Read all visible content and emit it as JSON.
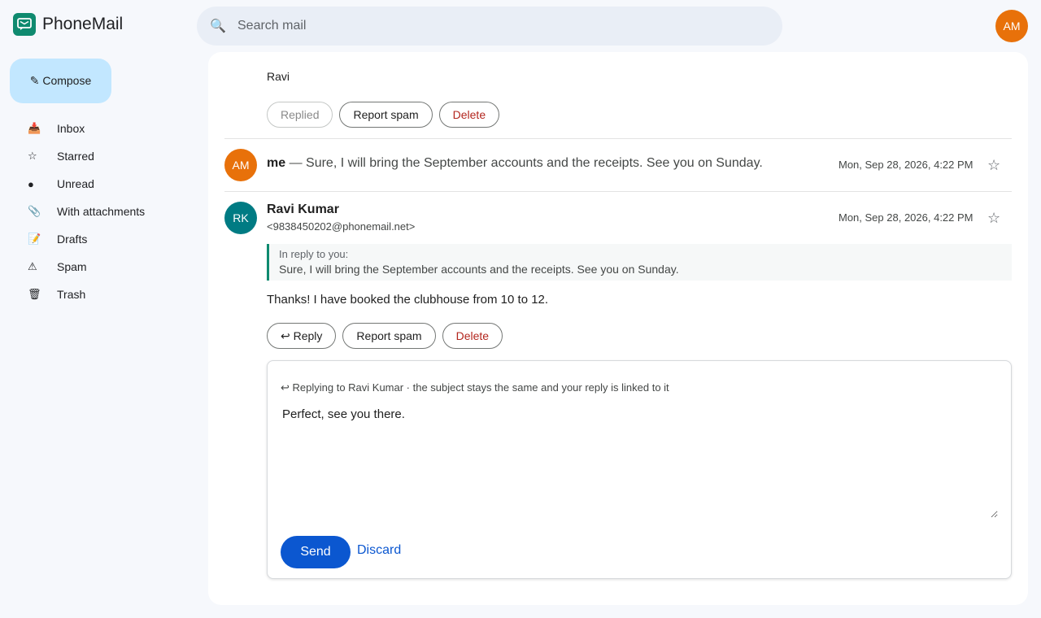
{
  "app": {
    "name": "PhoneMail",
    "logo_icon": "mail-chat-icon",
    "accent": "#0f8a6f"
  },
  "search": {
    "placeholder": "Search mail",
    "icon": "search-icon"
  },
  "user": {
    "initials": "AM",
    "color": "#e8710a"
  },
  "sidebar": {
    "compose_label": "✎ Compose",
    "items": [
      {
        "icon": "📥",
        "label": "Inbox"
      },
      {
        "icon": "☆",
        "label": "Starred"
      },
      {
        "icon": "●",
        "label": "Unread"
      },
      {
        "icon": "📎",
        "label": "With attachments"
      },
      {
        "icon": "📝",
        "label": "Drafts"
      },
      {
        "icon": "⚠",
        "label": "Spam"
      },
      {
        "icon": "🗑",
        "label": "Trash"
      }
    ]
  },
  "thread": {
    "first_message": {
      "signature": "Ravi",
      "actions": {
        "replied": "Replied",
        "report_spam": "Report spam",
        "delete": "Delete"
      }
    },
    "second_message": {
      "avatar_initials": "AM",
      "avatar_color": "#e8710a",
      "sender": "me",
      "separator": " — ",
      "snippet": "Sure, I will bring the September accounts and the receipts. See you on Sunday.",
      "date": "Mon, Sep 28, 2026, 4:22 PM",
      "star": "☆"
    },
    "third_message": {
      "avatar_initials": "RK",
      "avatar_color": "#007b83",
      "sender": "Ravi Kumar",
      "email": "<9838450202@phonemail.net>",
      "date": "Mon, Sep 28, 2026, 4:22 PM",
      "star": "☆",
      "quote_label": "In reply to you:",
      "quote_text": "Sure, I will bring the September accounts and the receipts. See you on Sunday.",
      "body": "Thanks! I have booked the clubhouse from 10 to 12.",
      "actions": {
        "reply": "↩ Reply",
        "report_spam": "Report spam",
        "delete": "Delete"
      }
    },
    "reply": {
      "hint": "↩ Replying to Ravi Kumar · the subject stays the same and your reply is linked to it",
      "text": "Perfect, see you there.",
      "send": "Send",
      "discard": "Discard"
    }
  }
}
